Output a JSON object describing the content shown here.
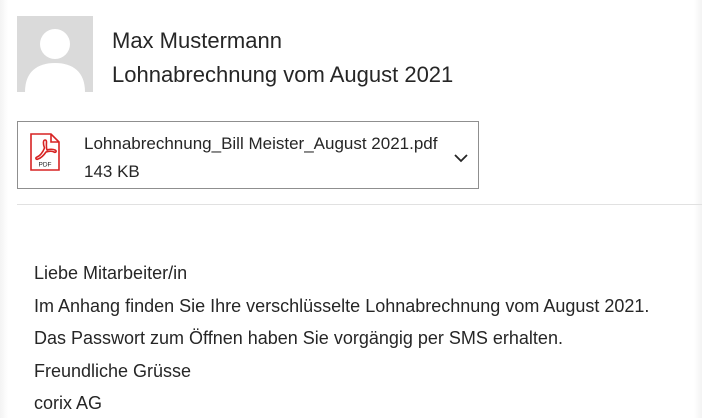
{
  "header": {
    "sender_name": "Max Mustermann",
    "subject": "Lohnabrechnung vom August 2021"
  },
  "attachment": {
    "icon": "pdf-file-icon",
    "filename": "Lohnabrechnung_Bill Meister_August 2021.pdf",
    "size": "143 KB",
    "type_label": "PDF",
    "menu_icon": "chevron-down-icon"
  },
  "body": {
    "lines": [
      "Liebe Mitarbeiter/in",
      "Im Anhang finden Sie Ihre verschlüsselte Lohnabrechnung vom August 2021.",
      "Das Passwort zum Öffnen haben Sie vorgängig per SMS erhalten.",
      "Freundliche Grüsse",
      "corix AG"
    ]
  },
  "colors": {
    "text": "#262626",
    "avatar_bg": "#dadada",
    "avatar_fg": "#ffffff",
    "pdf_red": "#d72323",
    "border": "#8f8f8f",
    "divider": "#e1e1e1"
  }
}
